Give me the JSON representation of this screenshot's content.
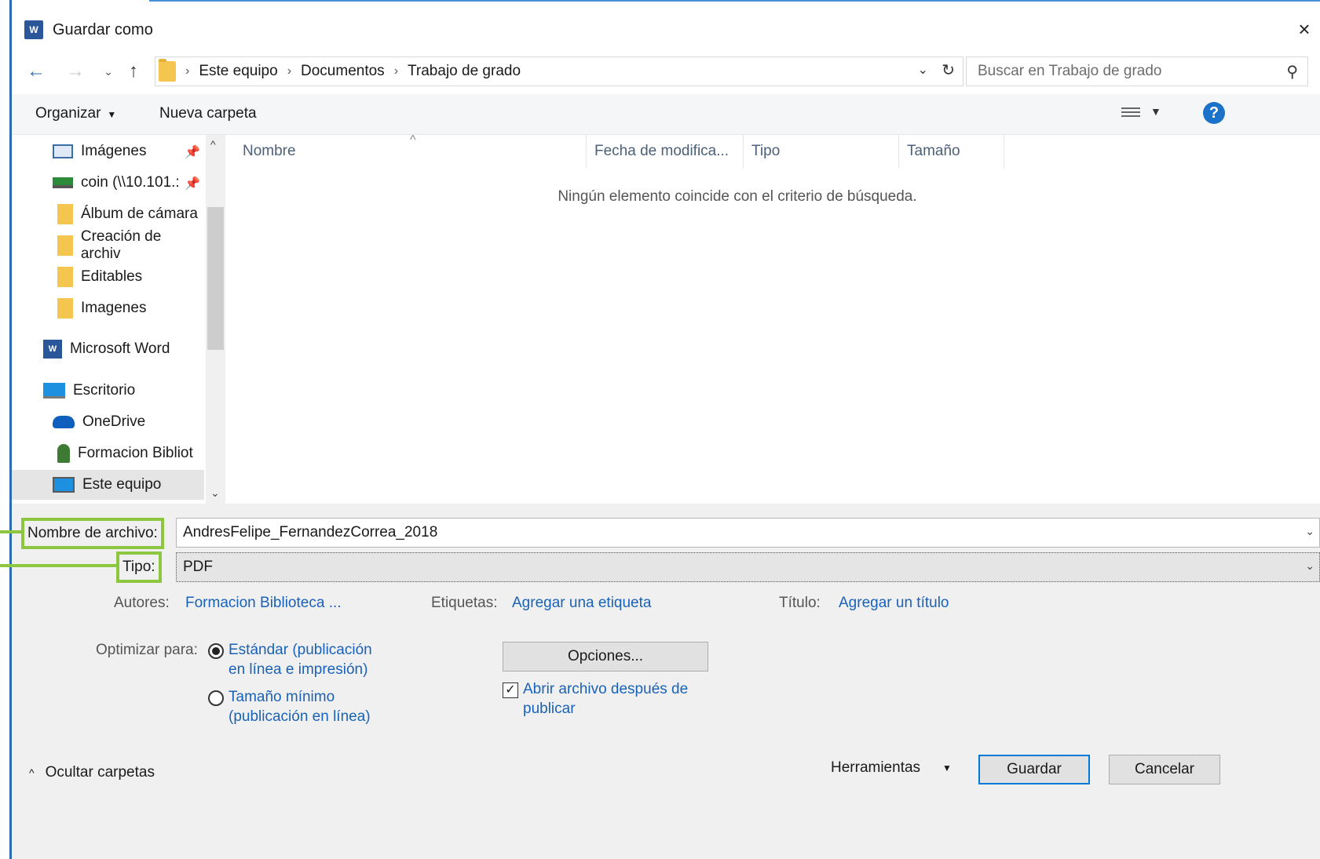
{
  "window": {
    "title": "Guardar como",
    "app_icon": "word-icon",
    "close_glyph": "×"
  },
  "nav": {
    "back_glyph": "←",
    "forward_glyph": "→",
    "recent_glyph": "⌄",
    "up_glyph": "↑",
    "breadcrumb": [
      "Este equipo",
      "Documentos",
      "Trabajo de grado"
    ],
    "separator": "›",
    "refresh_glyph": "↻",
    "dropdown_glyph": "⌄",
    "search_placeholder": "Buscar en Trabajo de grado",
    "search_glyph": "⚲"
  },
  "toolbar": {
    "organize_label": "Organizar",
    "new_folder_label": "Nueva carpeta",
    "help_glyph": "?",
    "caret_glyph": "▼"
  },
  "navpane": {
    "items": [
      {
        "label": "Imágenes",
        "icon": "pictures-icon",
        "pinned": true
      },
      {
        "label": "coin (\\\\10.101.:",
        "icon": "network-drive-icon",
        "pinned": true
      },
      {
        "label": "Álbum de cámara",
        "icon": "folder-icon"
      },
      {
        "label": "Creación de archiv",
        "icon": "folder-icon"
      },
      {
        "label": "Editables",
        "icon": "folder-icon"
      },
      {
        "label": "Imagenes",
        "icon": "folder-icon"
      },
      {
        "label": "Microsoft Word",
        "icon": "word-icon"
      },
      {
        "label": "Escritorio",
        "icon": "desktop-icon"
      },
      {
        "label": "OneDrive",
        "icon": "onedrive-icon"
      },
      {
        "label": "Formacion Bibliot",
        "icon": "user-icon"
      },
      {
        "label": "Este equipo",
        "icon": "this-pc-icon",
        "selected": true
      }
    ],
    "pin_glyph": "📌",
    "scroll_up_glyph": "^",
    "scroll_down_glyph": "⌄"
  },
  "filelist": {
    "columns": [
      "Nombre",
      "Fecha de modifica...",
      "Tipo",
      "Tamaño"
    ],
    "sort_glyph": "^",
    "empty_message": "Ningún elemento coincide con el criterio de búsqueda."
  },
  "form": {
    "filename_label": "Nombre de archivo:",
    "filename_value": "AndresFelipe_FernandezCorrea_2018",
    "type_label": "Tipo:",
    "type_value": "PDF",
    "field_caret": "⌄",
    "authors_label": "Autores:",
    "authors_value": "Formacion Biblioteca ...",
    "tags_label": "Etiquetas:",
    "tags_value": "Agregar una etiqueta",
    "title_label": "Título:",
    "title_value": "Agregar un título",
    "optimize_label": "Optimizar para:",
    "radio_standard_1": "Estándar (publicación",
    "radio_standard_2": "en línea e impresión)",
    "radio_min_1": "Tamaño mínimo",
    "radio_min_2": "(publicación en línea)",
    "options_button": "Opciones...",
    "open_after_1": "Abrir archivo después de",
    "open_after_2": "publicar",
    "check_glyph": "✓"
  },
  "footer": {
    "hide_folders": "Ocultar carpetas",
    "hide_caret": "^",
    "tools": "Herramientas",
    "tools_caret": "▼",
    "save": "Guardar",
    "cancel": "Cancelar"
  },
  "colors": {
    "accent": "#0078d7",
    "link": "#1a62b8",
    "highlight_box": "#8dc63f",
    "help": "#1a73c8"
  }
}
